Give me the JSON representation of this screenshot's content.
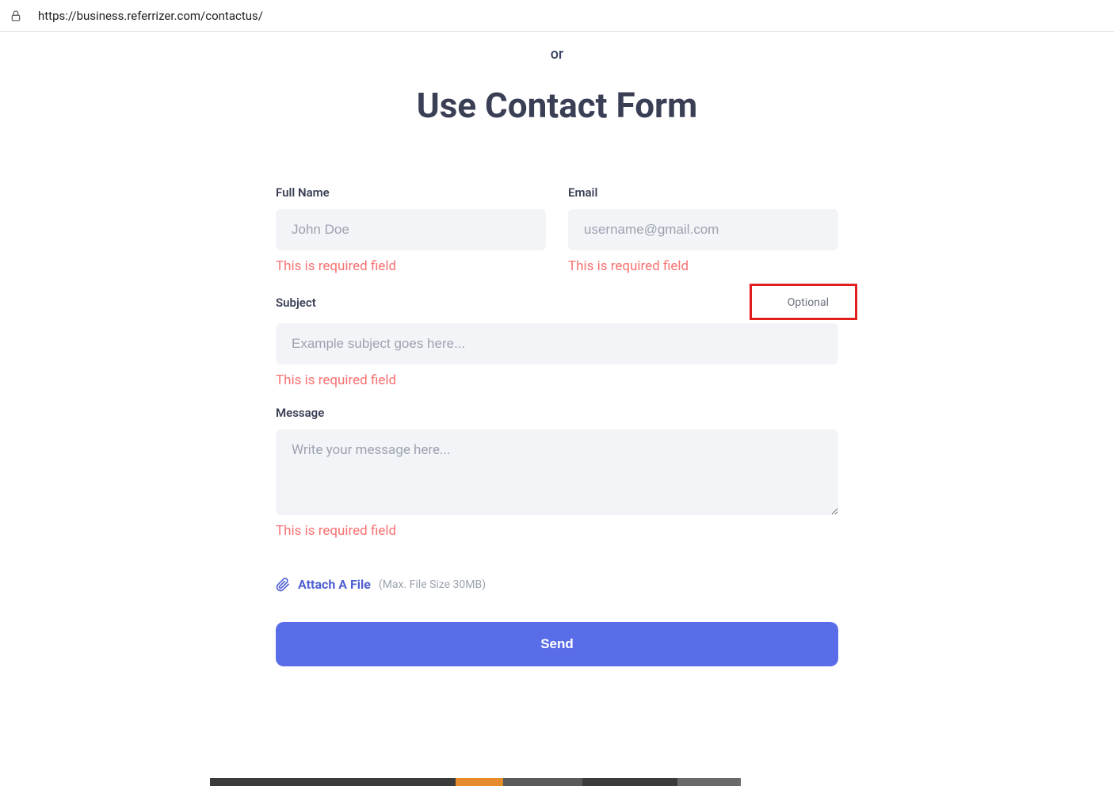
{
  "browser": {
    "url": "https://business.referrizer.com/contactus/"
  },
  "header": {
    "or_text": "or",
    "title": "Use Contact Form"
  },
  "form": {
    "full_name": {
      "label": "Full Name",
      "placeholder": "John Doe",
      "error": "This is required field"
    },
    "email": {
      "label": "Email",
      "placeholder": "username@gmail.com",
      "error": "This is required field"
    },
    "subject": {
      "label": "Subject",
      "optional_text": "Optional",
      "placeholder": "Example subject goes here...",
      "error": "This is required field"
    },
    "message": {
      "label": "Message",
      "placeholder": "Write your message here...",
      "error": "This is required field"
    },
    "attach": {
      "link_text": "Attach A File",
      "hint": "(Max. File Size 30MB)"
    },
    "submit": {
      "label": "Send"
    }
  }
}
